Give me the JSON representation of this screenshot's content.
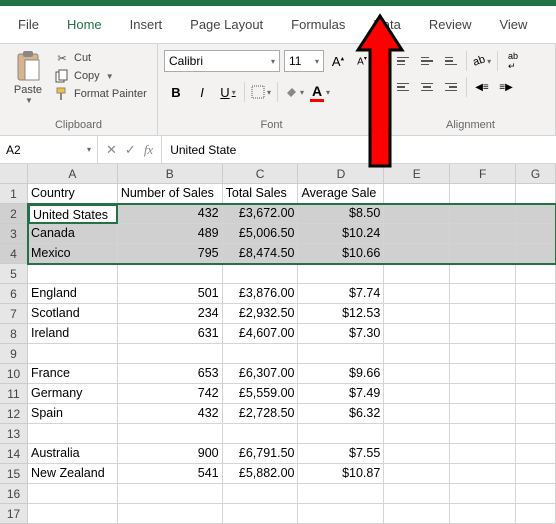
{
  "menu": {
    "file": "File",
    "home": "Home",
    "insert": "Insert",
    "page_layout": "Page Layout",
    "formulas": "Formulas",
    "data": "Data",
    "review": "Review",
    "view": "View"
  },
  "ribbon": {
    "clipboard": {
      "label": "Clipboard",
      "paste": "Paste",
      "cut": "Cut",
      "copy": "Copy",
      "format_painter": "Format Painter"
    },
    "font": {
      "label": "Font",
      "name": "Calibri",
      "size": "11"
    },
    "alignment": {
      "label": "Alignment"
    }
  },
  "name_box": "A2",
  "formula_bar": "United State",
  "columns": [
    "A",
    "B",
    "C",
    "D",
    "E",
    "F",
    "G"
  ],
  "rows": [
    "1",
    "2",
    "3",
    "4",
    "5",
    "6",
    "7",
    "8",
    "9",
    "10",
    "11",
    "12",
    "13",
    "14",
    "15",
    "16",
    "17"
  ],
  "headers": {
    "c0": "Country",
    "c1": "Number of Sales",
    "c2": "Total Sales",
    "c3": "Average Sale"
  },
  "sheet": [
    {
      "c0": "United States",
      "c1": "432",
      "c2": "£3,672.00",
      "c3": "$8.50"
    },
    {
      "c0": "Canada",
      "c1": "489",
      "c2": "£5,006.50",
      "c3": "$10.24"
    },
    {
      "c0": "Mexico",
      "c1": "795",
      "c2": "£8,474.50",
      "c3": "$10.66"
    },
    {
      "c0": "",
      "c1": "",
      "c2": "",
      "c3": ""
    },
    {
      "c0": "England",
      "c1": "501",
      "c2": "£3,876.00",
      "c3": "$7.74"
    },
    {
      "c0": "Scotland",
      "c1": "234",
      "c2": "£2,932.50",
      "c3": "$12.53"
    },
    {
      "c0": "Ireland",
      "c1": "631",
      "c2": "£4,607.00",
      "c3": "$7.30"
    },
    {
      "c0": "",
      "c1": "",
      "c2": "",
      "c3": ""
    },
    {
      "c0": "France",
      "c1": "653",
      "c2": "£6,307.00",
      "c3": "$9.66"
    },
    {
      "c0": "Germany",
      "c1": "742",
      "c2": "£5,559.00",
      "c3": "$7.49"
    },
    {
      "c0": "Spain",
      "c1": "432",
      "c2": "£2,728.50",
      "c3": "$6.32"
    },
    {
      "c0": "",
      "c1": "",
      "c2": "",
      "c3": ""
    },
    {
      "c0": "Australia",
      "c1": "900",
      "c2": "£6,791.50",
      "c3": "$7.55"
    },
    {
      "c0": "New Zealand",
      "c1": "541",
      "c2": "£5,882.00",
      "c3": "$10.87"
    },
    {
      "c0": "",
      "c1": "",
      "c2": "",
      "c3": ""
    },
    {
      "c0": "",
      "c1": "",
      "c2": "",
      "c3": ""
    }
  ],
  "active_cell_value": "United States"
}
